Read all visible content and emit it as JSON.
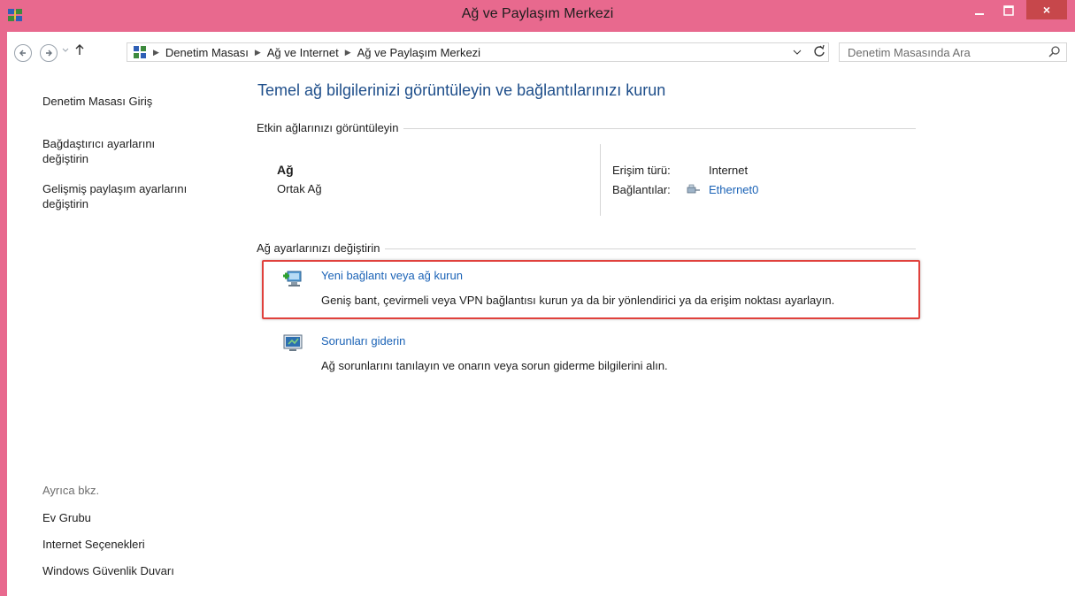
{
  "window": {
    "title": "Ağ ve Paylaşım Merkezi",
    "close_glyph": "×"
  },
  "navbar": {
    "breadcrumbs": [
      "Denetim Masası",
      "Ağ ve Internet",
      "Ağ ve Paylaşım Merkezi"
    ],
    "search_placeholder": "Denetim Masasında Ara"
  },
  "sidebar": {
    "home": "Denetim Masası Giriş",
    "adapter_settings": [
      "Bağdaştırıcı ayarlarını",
      "değiştirin"
    ],
    "advanced_sharing": [
      "Gelişmiş paylaşım ayarlarını",
      "değiştirin"
    ],
    "see_also_heading": "Ayrıca bkz.",
    "see_also": [
      "Ev Grubu",
      "Internet Seçenekleri",
      "Windows Güvenlik Duvarı"
    ]
  },
  "main": {
    "title": "Temel ağ bilgilerinizi görüntüleyin ve bağlantılarınızı kurun",
    "active_networks_heading": "Etkin ağlarınızı görüntüleyin",
    "network": {
      "name": "Ağ",
      "type": "Ortak Ağ",
      "access_label": "Erişim türü:",
      "access_value": "Internet",
      "connections_label": "Bağlantılar:",
      "connection_name": "Ethernet0"
    },
    "change_settings_heading": "Ağ ayarlarınızı değiştirin",
    "tasks": [
      {
        "title": "Yeni bağlantı veya ağ kurun",
        "description": "Geniş bant, çevirmeli veya VPN bağlantısı kurun ya da bir yönlendirici ya da erişim noktası ayarlayın."
      },
      {
        "title": "Sorunları giderin",
        "description": "Ağ sorunlarını tanılayın ve onarın veya sorun giderme bilgilerini alın."
      }
    ]
  },
  "colors": {
    "frame": "#e8698e",
    "link": "#1a62b6",
    "title": "#1e4e8a",
    "highlight": "#e0413c"
  }
}
